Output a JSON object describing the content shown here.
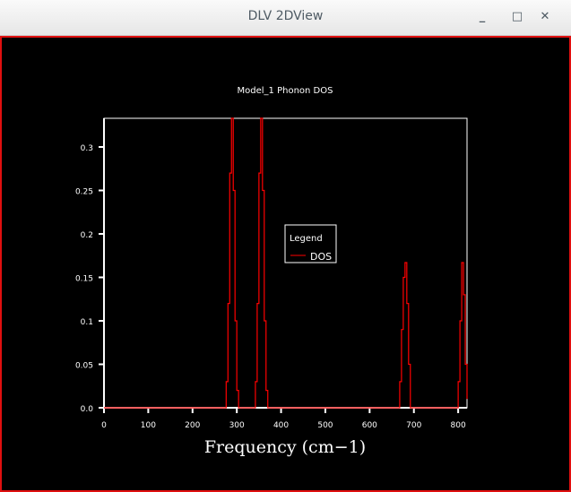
{
  "window": {
    "title": "DLV 2DView",
    "minimize": "_",
    "maximize": "□",
    "close": "✕"
  },
  "chart_data": {
    "type": "line",
    "title": "Model_1 Phonon DOS",
    "xlabel": "Frequency (cm−1)",
    "ylabel": "",
    "xlim": [
      0,
      820
    ],
    "ylim": [
      0,
      0.333
    ],
    "xticks": [
      0,
      100,
      200,
      300,
      400,
      500,
      600,
      700,
      800
    ],
    "yticks": [
      0.0,
      0.05,
      0.1,
      0.15,
      0.2,
      0.25,
      0.3
    ],
    "ytick_labels": [
      "0.0",
      "0.05",
      "0.1",
      "0.15",
      "0.2",
      "0.25",
      "0.3"
    ],
    "legend": {
      "title": "Legend",
      "placement": "center",
      "entries": [
        {
          "name": "DOS",
          "color": "#ff0000"
        }
      ]
    },
    "series": [
      {
        "name": "DOS",
        "color": "#ff0000",
        "x": [
          0,
          272,
          276,
          280,
          284,
          288,
          292,
          296,
          300,
          304,
          338,
          342,
          346,
          350,
          354,
          358,
          362,
          366,
          370,
          664,
          668,
          672,
          676,
          680,
          684,
          688,
          692,
          796,
          800,
          804,
          808,
          812,
          816,
          820
        ],
        "y": [
          0,
          0,
          0.03,
          0.12,
          0.27,
          0.333,
          0.25,
          0.1,
          0.02,
          0,
          0,
          0.03,
          0.12,
          0.27,
          0.333,
          0.25,
          0.1,
          0.02,
          0,
          0,
          0.03,
          0.09,
          0.15,
          0.167,
          0.12,
          0.05,
          0,
          0,
          0.03,
          0.1,
          0.167,
          0.13,
          0.05,
          0.01
        ]
      }
    ]
  }
}
